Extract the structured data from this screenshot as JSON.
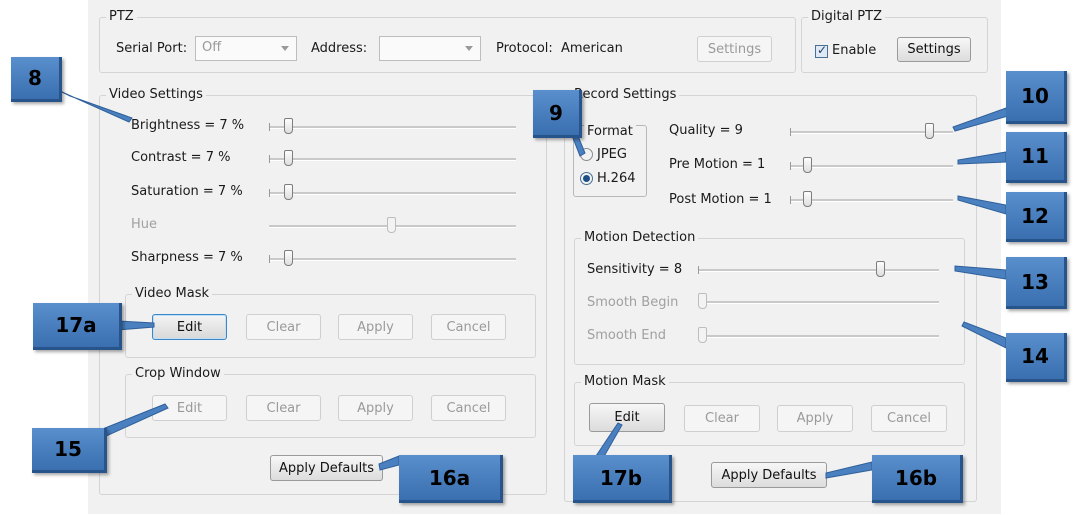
{
  "ptz": {
    "title": "PTZ",
    "serial_port_label": "Serial Port:",
    "serial_port_value": "Off",
    "address_label": "Address:",
    "address_value": "",
    "protocol_label": "Protocol:",
    "protocol_value": "American",
    "settings_label": "Settings"
  },
  "digital_ptz": {
    "title": "Digital PTZ",
    "enable_label": "Enable",
    "enable_checked": true,
    "settings_label": "Settings"
  },
  "video_settings": {
    "title": "Video Settings",
    "sliders": [
      {
        "label": "Brightness = 7 %",
        "value_pct": 7,
        "enabled": true
      },
      {
        "label": "Contrast = 7 %",
        "value_pct": 7,
        "enabled": true
      },
      {
        "label": "Saturation = 7 %",
        "value_pct": 7,
        "enabled": true
      },
      {
        "label": "Hue",
        "value_pct": 50,
        "enabled": false
      },
      {
        "label": "Sharpness = 7 %",
        "value_pct": 7,
        "enabled": true
      }
    ],
    "video_mask": {
      "title": "Video Mask",
      "edit": "Edit",
      "clear": "Clear",
      "apply": "Apply",
      "cancel": "Cancel"
    },
    "crop_window": {
      "title": "Crop Window",
      "edit": "Edit",
      "clear": "Clear",
      "apply": "Apply",
      "cancel": "Cancel"
    },
    "apply_defaults": "Apply Defaults"
  },
  "record_settings": {
    "title": "Record Settings",
    "format": {
      "title": "Format",
      "options": [
        "JPEG",
        "H.264"
      ],
      "selected": "H.264"
    },
    "sliders": [
      {
        "label": "Quality = 9",
        "value_pct": 90,
        "enabled": true
      },
      {
        "label": "Pre Motion = 1",
        "value_pct": 10,
        "enabled": true
      },
      {
        "label": "Post Motion = 1",
        "value_pct": 10,
        "enabled": true
      }
    ],
    "motion_detection": {
      "title": "Motion Detection",
      "sliders": [
        {
          "label": "Sensitivity = 8",
          "value_pct": 75,
          "enabled": true
        },
        {
          "label": "Smooth Begin",
          "value_pct": 0,
          "enabled": false
        },
        {
          "label": "Smooth End",
          "value_pct": 0,
          "enabled": false
        }
      ]
    },
    "motion_mask": {
      "title": "Motion Mask",
      "edit": "Edit",
      "clear": "Clear",
      "apply": "Apply",
      "cancel": "Cancel"
    },
    "apply_defaults": "Apply Defaults"
  },
  "callouts": [
    "8",
    "9",
    "10",
    "11",
    "12",
    "13",
    "14",
    "15",
    "16a",
    "16b",
    "17a",
    "17b"
  ],
  "colors": {
    "callout_blue": "#4a80c0",
    "panel_bg": "#f1f1f1",
    "focus_border": "#3d86c6"
  }
}
